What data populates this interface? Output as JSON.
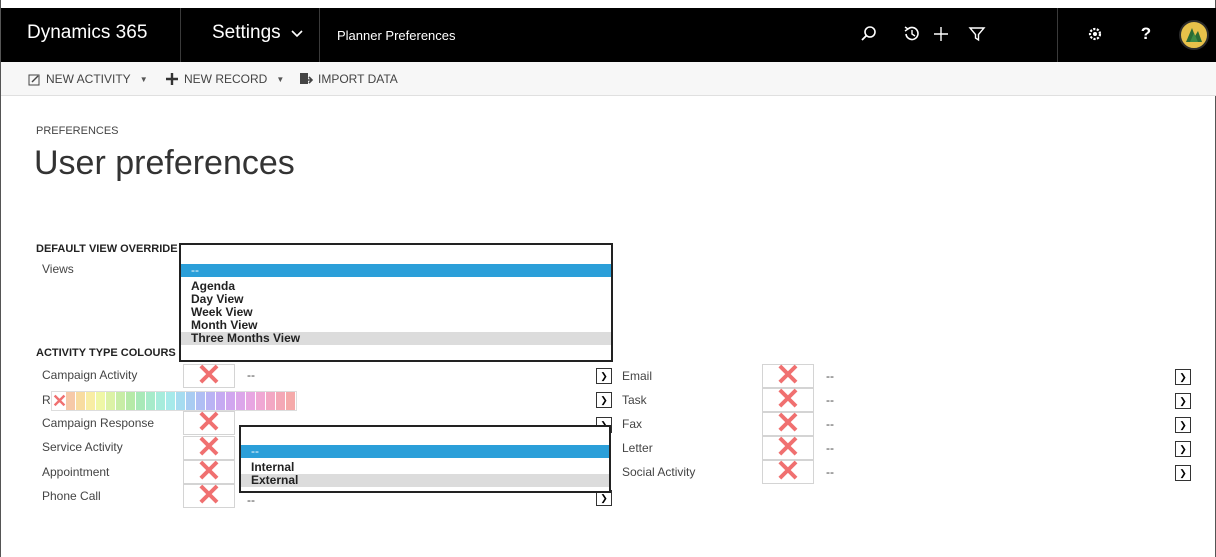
{
  "app": {
    "brand": "Dynamics 365",
    "area": "Settings",
    "page": "Planner Preferences"
  },
  "icons": [
    "search-icon",
    "history-icon",
    "plus-icon",
    "filter-icon",
    "gear-icon",
    "help-icon",
    "avatar"
  ],
  "commands": {
    "new_activity": "NEW ACTIVITY",
    "new_record": "NEW RECORD",
    "import_data": "IMPORT DATA"
  },
  "header": {
    "breadcrumb": "PREFERENCES",
    "title": "User preferences"
  },
  "default_view": {
    "section": "DEFAULT VIEW OVERRIDE",
    "views_label": "Views",
    "options": [
      "--",
      "Agenda",
      "Day View",
      "Week View",
      "Month View",
      "Three Months View"
    ],
    "selected": "--",
    "hovered": "Three Months View"
  },
  "activity_colours": {
    "section": "ACTIVITY TYPE COLOURS",
    "left": [
      {
        "label": "Campaign Activity",
        "value": "--"
      },
      {
        "label": "Re",
        "value": ""
      },
      {
        "label": "Campaign Response",
        "value": ""
      },
      {
        "label": "Service Activity",
        "value": ""
      },
      {
        "label": "Appointment",
        "value": ""
      },
      {
        "label": "Phone Call",
        "value": "--"
      }
    ],
    "right": [
      {
        "label": "Email",
        "value": "--"
      },
      {
        "label": "Task",
        "value": "--"
      },
      {
        "label": "Fax",
        "value": "--"
      },
      {
        "label": "Letter",
        "value": "--"
      },
      {
        "label": "Social Activity",
        "value": "--"
      }
    ]
  },
  "direction_popup": {
    "options": [
      "--",
      "Internal",
      "External"
    ],
    "selected": "--",
    "hovered": "External"
  },
  "palette": {
    "colors": [
      "#f6c9a8",
      "#f8dca0",
      "#f8eda4",
      "#eff7a6",
      "#dcf2a6",
      "#c8eda6",
      "#b6eaa8",
      "#a8e9b8",
      "#a6ebca",
      "#a6ecdc",
      "#a6eaea",
      "#a6dcf0",
      "#a9ccf2",
      "#b0bef4",
      "#bab3f4",
      "#c6aaf2",
      "#d1a6ef",
      "#dca6ea",
      "#e8a6e2",
      "#f0a8d4",
      "#f3a8c4",
      "#f4a8b6",
      "#f5aaaa"
    ]
  },
  "colors": {
    "accent": "#2b9fd9",
    "swatch_x": "#f07070"
  }
}
